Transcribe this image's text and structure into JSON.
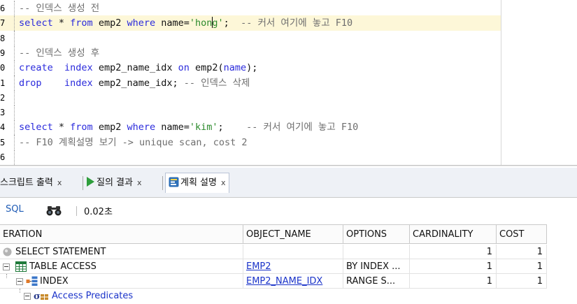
{
  "editor": {
    "lines": [
      {
        "num": "6",
        "tokens": [
          {
            "c": "cmt",
            "t": "-- 인덱스 생성 전"
          }
        ]
      },
      {
        "num": "7",
        "current": true,
        "tokens": [
          {
            "c": "kw",
            "t": "select"
          },
          {
            "c": "tx",
            "t": " * "
          },
          {
            "c": "kw",
            "t": "from"
          },
          {
            "c": "tx",
            "t": " emp2 "
          },
          {
            "c": "kw",
            "t": "where"
          },
          {
            "c": "tx",
            "t": " name="
          },
          {
            "c": "str",
            "t": "'hon"
          },
          {
            "c": "caret",
            "t": ""
          },
          {
            "c": "str",
            "t": "g'"
          },
          {
            "c": "tx",
            "t": ";  "
          },
          {
            "c": "cmt",
            "t": "-- 커서 여기에 놓고 F10"
          }
        ]
      },
      {
        "num": "8",
        "tokens": []
      },
      {
        "num": "9",
        "tokens": [
          {
            "c": "cmt",
            "t": "-- 인덱스 생성 후"
          }
        ]
      },
      {
        "num": "0",
        "tokens": [
          {
            "c": "kw",
            "t": "create"
          },
          {
            "c": "tx",
            "t": "  "
          },
          {
            "c": "kw",
            "t": "index"
          },
          {
            "c": "tx",
            "t": " emp2_name_idx "
          },
          {
            "c": "kw",
            "t": "on"
          },
          {
            "c": "tx",
            "t": " emp2("
          },
          {
            "c": "kw",
            "t": "name"
          },
          {
            "c": "tx",
            "t": ");"
          }
        ]
      },
      {
        "num": "1",
        "tokens": [
          {
            "c": "kw",
            "t": "drop"
          },
          {
            "c": "tx",
            "t": "    "
          },
          {
            "c": "kw",
            "t": "index"
          },
          {
            "c": "tx",
            "t": " emp2_name_idx; "
          },
          {
            "c": "cmt",
            "t": "-- 인덱스 삭제"
          }
        ]
      },
      {
        "num": "2",
        "tokens": []
      },
      {
        "num": "3",
        "tokens": []
      },
      {
        "num": "4",
        "tokens": [
          {
            "c": "kw",
            "t": "select"
          },
          {
            "c": "tx",
            "t": " * "
          },
          {
            "c": "kw",
            "t": "from"
          },
          {
            "c": "tx",
            "t": " emp2 "
          },
          {
            "c": "kw",
            "t": "where"
          },
          {
            "c": "tx",
            "t": " name="
          },
          {
            "c": "str",
            "t": "'kim'"
          },
          {
            "c": "tx",
            "t": ";    "
          },
          {
            "c": "cmt",
            "t": "-- 커서 여기에 놓고 F10"
          }
        ]
      },
      {
        "num": "5",
        "tokens": [
          {
            "c": "cmt",
            "t": "-- F10 계획설명 보기 -> unique scan, cost 2"
          }
        ]
      },
      {
        "num": "6",
        "tokens": []
      }
    ]
  },
  "tabs": [
    {
      "label": "스크립트 출력",
      "close": "x"
    },
    {
      "label": "질의 결과",
      "close": "x",
      "icon": "play-icon"
    },
    {
      "label": "계획 설명",
      "close": "x",
      "icon": "explain-plan-icon",
      "active": true
    }
  ],
  "toolbar": {
    "sql_label": "SQL",
    "time_label": "0.02초"
  },
  "grid": {
    "columns": [
      "ERATION",
      "OBJECT_NAME",
      "OPTIONS",
      "CARDINALITY",
      "COST"
    ],
    "rows": [
      {
        "operation": "SELECT STATEMENT",
        "object_name": "",
        "options": "",
        "cardinality": "1",
        "cost": "1"
      },
      {
        "operation": "TABLE ACCESS",
        "object_name": "EMP2",
        "options": "BY INDEX ...",
        "cardinality": "1",
        "cost": "1"
      },
      {
        "operation": "INDEX",
        "object_name": "EMP2_NAME_IDX",
        "options": "RANGE S...",
        "cardinality": "1",
        "cost": "1"
      },
      {
        "operation": "Access Predicates",
        "object_name": "",
        "options": "",
        "cardinality": "",
        "cost": ""
      }
    ]
  },
  "colors": {
    "keyword": "#2a2adc",
    "string": "#2b8a2b",
    "comment": "#6e6e6e",
    "link": "#1a33c9",
    "current_line": "#fdf7d8"
  }
}
